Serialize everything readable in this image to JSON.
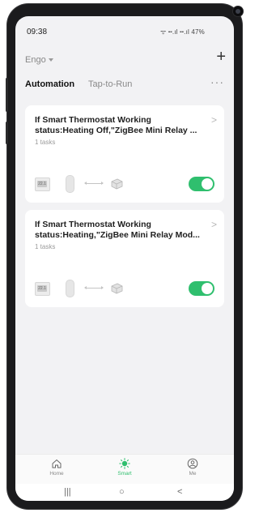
{
  "status_bar": {
    "time": "09:38",
    "icons_text": "ᯤ ╍.ıl ╍.ıl 47%",
    "battery_percent": "47%"
  },
  "header": {
    "home_name": "Engo",
    "add_icon": "plus-icon"
  },
  "tabs": [
    {
      "label": "Automation",
      "active": true
    },
    {
      "label": "Tap-to-Run",
      "active": false
    }
  ],
  "more_icon": "more-horizontal-icon",
  "automations": [
    {
      "title_line1": "If Smart Thermostat Working",
      "title_line2": "status:Heating Off,\"ZigBee Mini Relay ...",
      "tasks": "1 tasks",
      "enabled": true,
      "thermo_display": "22.1"
    },
    {
      "title_line1": "If Smart Thermostat Working",
      "title_line2": "status:Heating,\"ZigBee Mini Relay Mod...",
      "tasks": "1 tasks",
      "enabled": true,
      "thermo_display": "22.1"
    }
  ],
  "bottom_nav": [
    {
      "label": "Home",
      "icon": "home-icon",
      "active": false
    },
    {
      "label": "Smart",
      "icon": "smart-sun-icon",
      "active": true
    },
    {
      "label": "Me",
      "icon": "user-circle-icon",
      "active": false
    }
  ],
  "system_nav": {
    "recents": "|||",
    "home": "○",
    "back": "<"
  },
  "colors": {
    "accent": "#2fbf6e",
    "toggle_on": "#2fbf6e",
    "screen_bg": "#f2f2f4"
  }
}
